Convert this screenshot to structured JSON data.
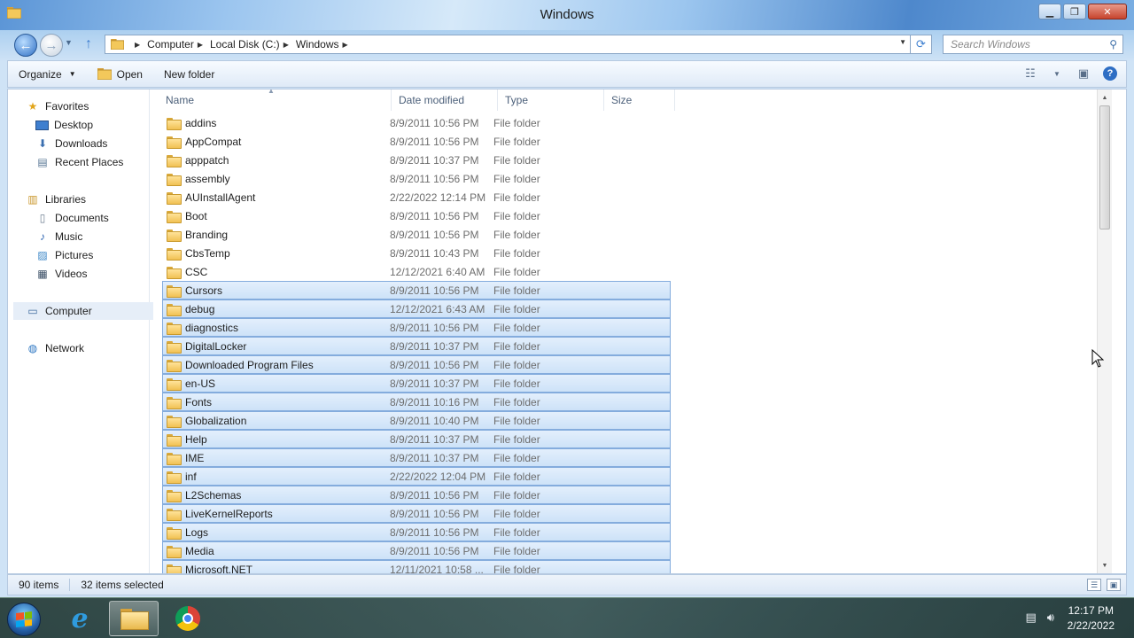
{
  "window": {
    "title": "Windows"
  },
  "nav": {
    "breadcrumbs": [
      "Computer",
      "Local Disk (C:)",
      "Windows"
    ],
    "search_placeholder": "Search Windows"
  },
  "command_bar": {
    "organize": "Organize",
    "open": "Open",
    "new_folder": "New folder"
  },
  "nav_pane": {
    "favorites": {
      "label": "Favorites",
      "items": [
        "Desktop",
        "Downloads",
        "Recent Places"
      ]
    },
    "libraries": {
      "label": "Libraries",
      "items": [
        "Documents",
        "Music",
        "Pictures",
        "Videos"
      ]
    },
    "computer": "Computer",
    "network": "Network"
  },
  "columns": {
    "name": "Name",
    "date_modified": "Date modified",
    "type": "Type",
    "size": "Size"
  },
  "files": [
    {
      "name": "addins",
      "date": "8/9/2011 10:56 PM",
      "type": "File folder",
      "selected": false
    },
    {
      "name": "AppCompat",
      "date": "8/9/2011 10:56 PM",
      "type": "File folder",
      "selected": false
    },
    {
      "name": "apppatch",
      "date": "8/9/2011 10:37 PM",
      "type": "File folder",
      "selected": false
    },
    {
      "name": "assembly",
      "date": "8/9/2011 10:56 PM",
      "type": "File folder",
      "selected": false
    },
    {
      "name": "AUInstallAgent",
      "date": "2/22/2022 12:14 PM",
      "type": "File folder",
      "selected": false
    },
    {
      "name": "Boot",
      "date": "8/9/2011 10:56 PM",
      "type": "File folder",
      "selected": false
    },
    {
      "name": "Branding",
      "date": "8/9/2011 10:56 PM",
      "type": "File folder",
      "selected": false
    },
    {
      "name": "CbsTemp",
      "date": "8/9/2011 10:43 PM",
      "type": "File folder",
      "selected": false
    },
    {
      "name": "CSC",
      "date": "12/12/2021 6:40 AM",
      "type": "File folder",
      "selected": false
    },
    {
      "name": "Cursors",
      "date": "8/9/2011 10:56 PM",
      "type": "File folder",
      "selected": true
    },
    {
      "name": "debug",
      "date": "12/12/2021 6:43 AM",
      "type": "File folder",
      "selected": true
    },
    {
      "name": "diagnostics",
      "date": "8/9/2011 10:56 PM",
      "type": "File folder",
      "selected": true
    },
    {
      "name": "DigitalLocker",
      "date": "8/9/2011 10:37 PM",
      "type": "File folder",
      "selected": true
    },
    {
      "name": "Downloaded Program Files",
      "date": "8/9/2011 10:56 PM",
      "type": "File folder",
      "selected": true
    },
    {
      "name": "en-US",
      "date": "8/9/2011 10:37 PM",
      "type": "File folder",
      "selected": true
    },
    {
      "name": "Fonts",
      "date": "8/9/2011 10:16 PM",
      "type": "File folder",
      "selected": true
    },
    {
      "name": "Globalization",
      "date": "8/9/2011 10:40 PM",
      "type": "File folder",
      "selected": true
    },
    {
      "name": "Help",
      "date": "8/9/2011 10:37 PM",
      "type": "File folder",
      "selected": true
    },
    {
      "name": "IME",
      "date": "8/9/2011 10:37 PM",
      "type": "File folder",
      "selected": true
    },
    {
      "name": "inf",
      "date": "2/22/2022 12:04 PM",
      "type": "File folder",
      "selected": true
    },
    {
      "name": "L2Schemas",
      "date": "8/9/2011 10:56 PM",
      "type": "File folder",
      "selected": true
    },
    {
      "name": "LiveKernelReports",
      "date": "8/9/2011 10:56 PM",
      "type": "File folder",
      "selected": true
    },
    {
      "name": "Logs",
      "date": "8/9/2011 10:56 PM",
      "type": "File folder",
      "selected": true
    },
    {
      "name": "Media",
      "date": "8/9/2011 10:56 PM",
      "type": "File folder",
      "selected": true
    },
    {
      "name": "Microsoft.NET",
      "date": "12/11/2021 10:58 ...",
      "type": "File folder",
      "selected": true
    }
  ],
  "status": {
    "item_count": "90 items",
    "selected_count": "32 items selected"
  },
  "taskbar": {
    "time": "12:17 PM",
    "date": "2/22/2022"
  },
  "colors": {
    "selection_bg": "#cde2f8",
    "selection_border": "#84acdd",
    "window_frame": "#a8cdef"
  },
  "icons": {
    "back": "back-arrow-icon",
    "forward": "forward-arrow-icon",
    "up": "up-arrow-icon",
    "search": "search-icon",
    "help": "help-icon",
    "folder": "folder-icon"
  }
}
